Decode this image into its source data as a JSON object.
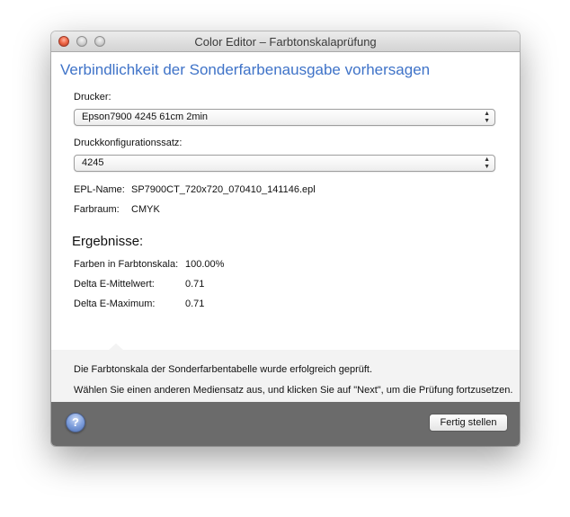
{
  "window": {
    "title": "Color Editor – Farbtonskalaprüfung"
  },
  "heading": "Verbindlichkeit der Sonderfarbenausgabe vorhersagen",
  "printer": {
    "label": "Drucker:",
    "selected": "Epson7900 4245 61cm 2min"
  },
  "config": {
    "label": "Druckkonfigurationssatz:",
    "selected": "4245"
  },
  "epl": {
    "label": "EPL-Name:",
    "value": "SP7900CT_720x720_070410_141146.epl"
  },
  "colorspace": {
    "label": "Farbraum:",
    "value": "CMYK"
  },
  "results": {
    "heading": "Ergebnisse:",
    "rows": [
      {
        "label": "Farben in Farbtonskala:",
        "value": "100.00%"
      },
      {
        "label": "Delta E-Mittelwert:",
        "value": "0.71"
      },
      {
        "label": "Delta E-Maximum:",
        "value": "0.71"
      }
    ]
  },
  "info": {
    "line1": "Die Farbtonskala der Sonderfarbentabelle wurde erfolgreich geprüft.",
    "line2": "Wählen Sie einen anderen Mediensatz aus, und klicken Sie auf \"Next\", um die Prüfung fortzusetzen."
  },
  "footer": {
    "help_symbol": "?",
    "done_label": "Fertig stellen"
  },
  "icons": {
    "help": "help-icon",
    "popup_arrows": "up-down-arrows-icon"
  },
  "colors": {
    "heading": "#3f73c8",
    "bottombar": "#6b6b6b",
    "close_button": "#f06a4a"
  }
}
